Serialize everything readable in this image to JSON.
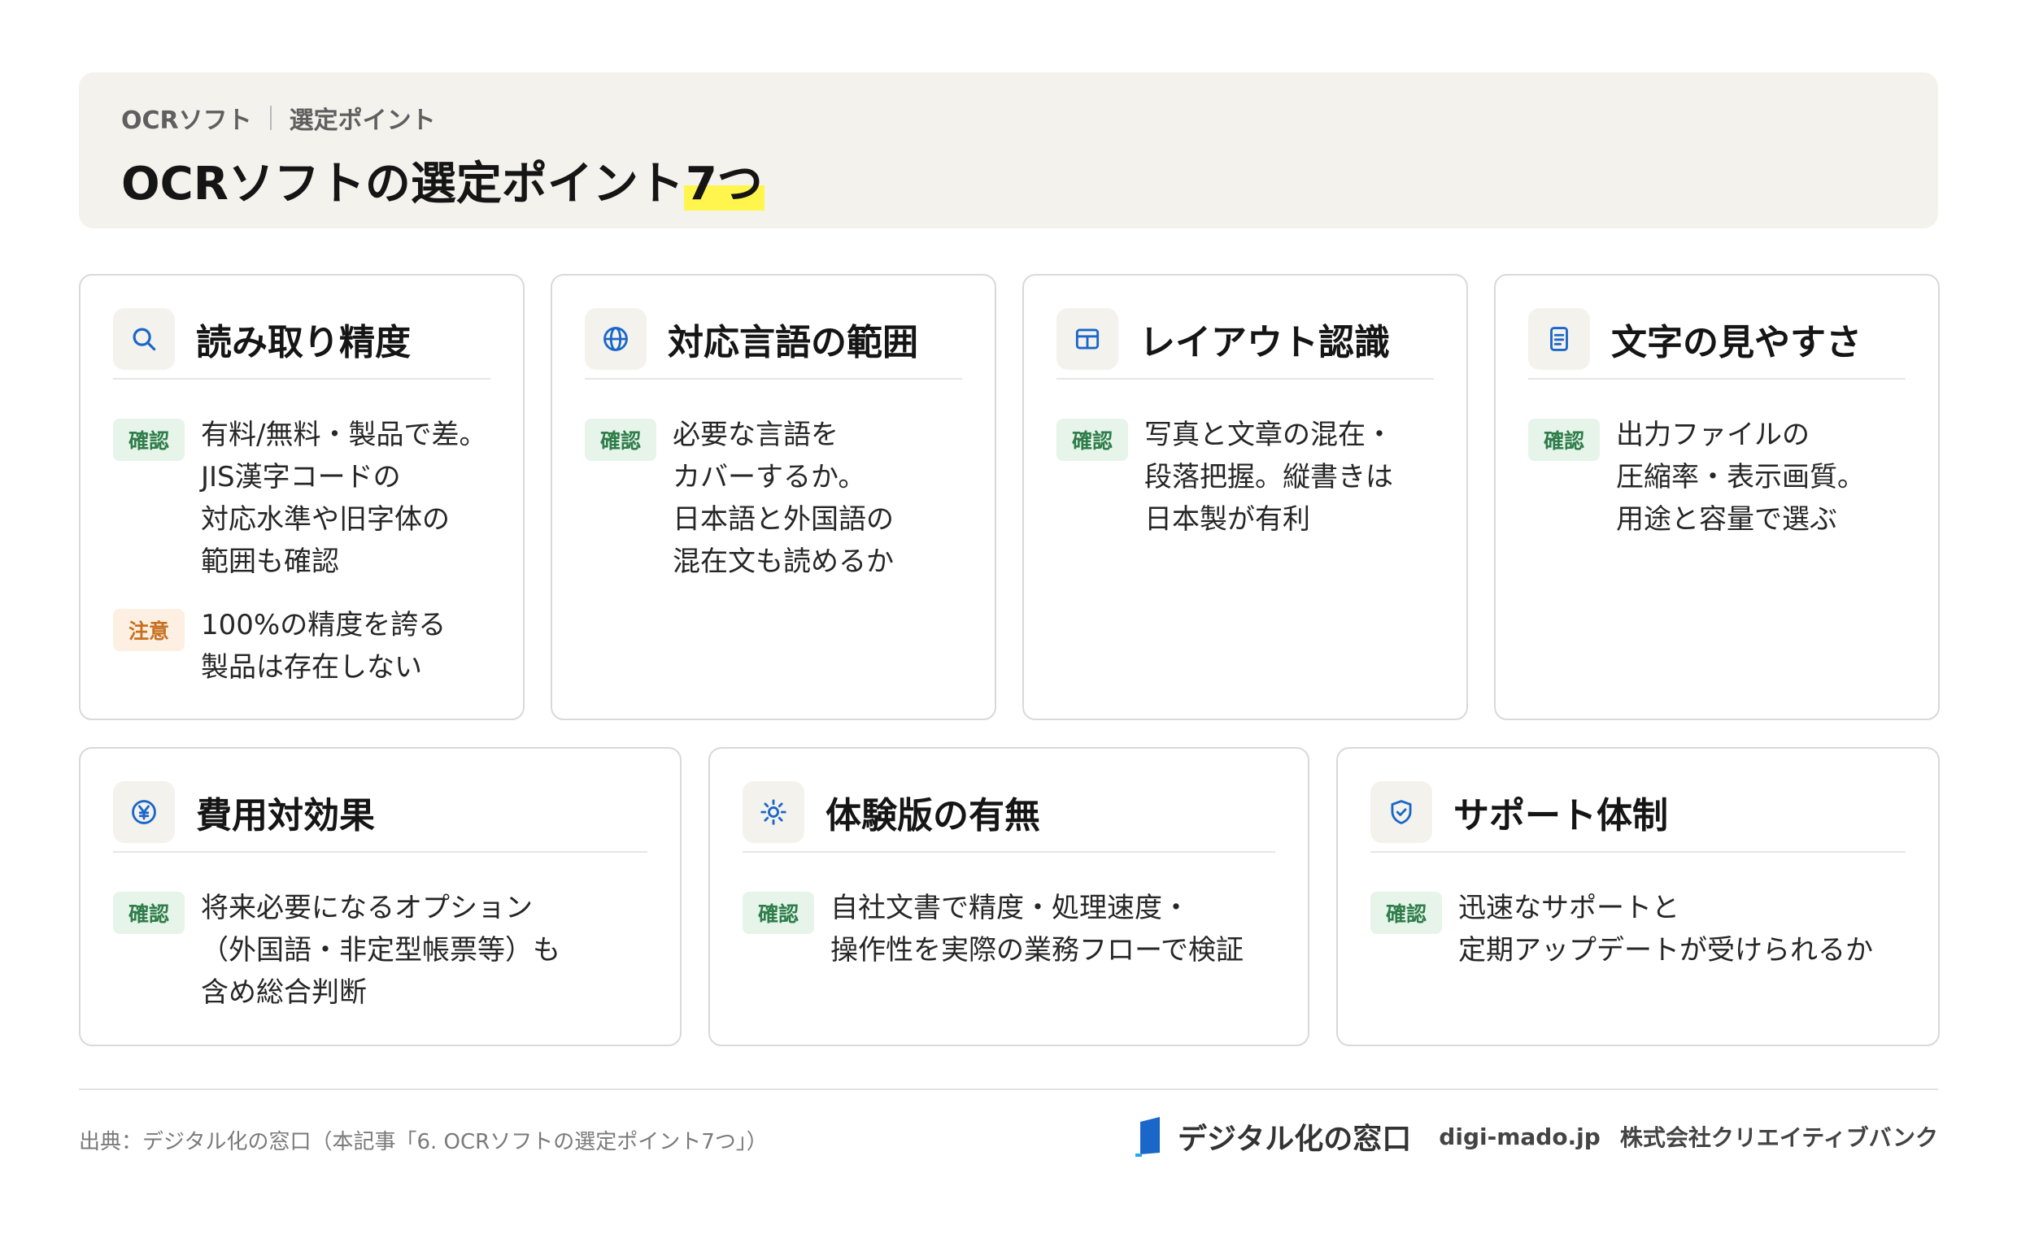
{
  "header": {
    "breadcrumb": [
      "OCRソフト",
      "選定ポイント"
    ],
    "title_main": "OCRソフトの選定ポイント",
    "title_highlight": "7つ"
  },
  "colors": {
    "accent_blue": "#1a67c9",
    "confirm_green": "#2e7d4a",
    "caution_orange": "#c7701f",
    "highlight_yellow": "#fff54d"
  },
  "cards": [
    {
      "icon": "search-icon",
      "title": "読み取り精度",
      "items": [
        {
          "badge": "確認",
          "type": "confirm",
          "text": "有料/無料・製品で差。\nJIS漢字コードの\n対応水準や旧字体の\n範囲も確認"
        },
        {
          "badge": "注意",
          "type": "caution",
          "text": "100%の精度を誇る\n製品は存在しない"
        }
      ]
    },
    {
      "icon": "globe-icon",
      "title": "対応言語の範囲",
      "items": [
        {
          "badge": "確認",
          "type": "confirm",
          "text": "必要な言語を\nカバーするか。\n日本語と外国語の\n混在文も読めるか"
        }
      ]
    },
    {
      "icon": "layout-icon",
      "title": "レイアウト認識",
      "items": [
        {
          "badge": "確認",
          "type": "confirm",
          "text": "写真と文章の混在・\n段落把握。縦書きは\n日本製が有利"
        }
      ]
    },
    {
      "icon": "document-icon",
      "title": "文字の見やすさ",
      "items": [
        {
          "badge": "確認",
          "type": "confirm",
          "text": "出力ファイルの\n圧縮率・表示画質。\n用途と容量で選ぶ"
        }
      ]
    },
    {
      "icon": "yen-icon",
      "title": "費用対効果",
      "items": [
        {
          "badge": "確認",
          "type": "confirm",
          "text": "将来必要になるオプション\n（外国語・非定型帳票等）も\n含め総合判断"
        }
      ]
    },
    {
      "icon": "sun-icon",
      "title": "体験版の有無",
      "items": [
        {
          "badge": "確認",
          "type": "confirm",
          "text": "自社文書で精度・処理速度・\n操作性を実際の業務フローで検証"
        }
      ]
    },
    {
      "icon": "shield-check-icon",
      "title": "サポート体制",
      "items": [
        {
          "badge": "確認",
          "type": "confirm",
          "text": "迅速なサポートと\n定期アップデートが受けられるか"
        }
      ]
    }
  ],
  "footer": {
    "source": "出典：デジタル化の窓口（本記事「6. OCRソフトの選定ポイント7つ」）",
    "brand_name": "デジタル化の窓口",
    "domain": "digi-mado.jp",
    "company": "株式会社クリエイティブバンク"
  }
}
